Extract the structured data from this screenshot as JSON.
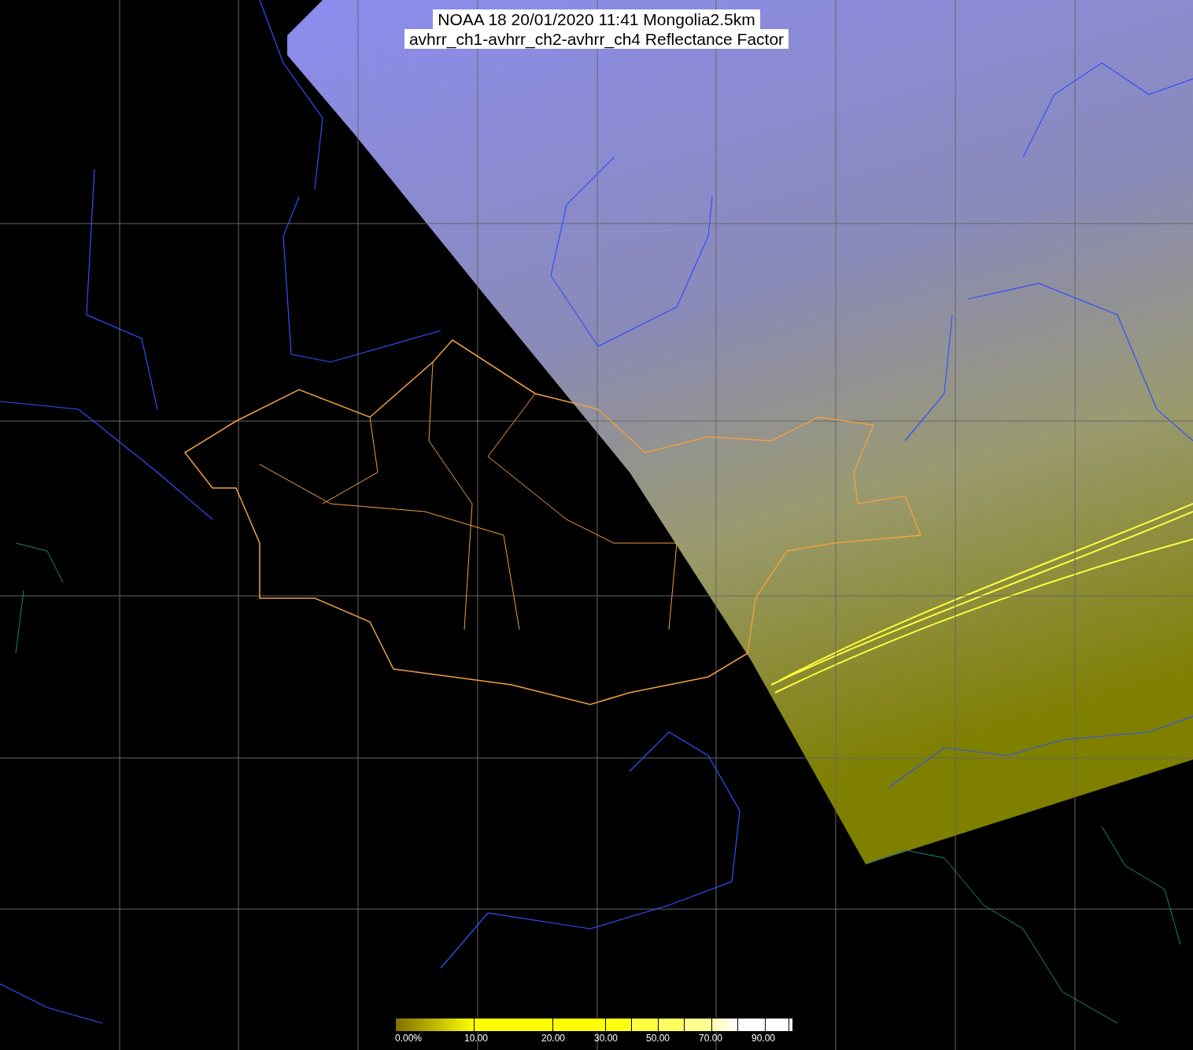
{
  "title": {
    "lines": [
      "NOAA 18 20/01/2020 11:41 Mongolia2.5km",
      "avhrr_ch1-avhrr_ch2-avhrr_ch4 Reflectance Factor"
    ]
  },
  "colorbar": {
    "labels": [
      "0.00%",
      "10.00",
      "20.00",
      "30.00",
      "50.00",
      "70.00",
      "90.00"
    ]
  }
}
